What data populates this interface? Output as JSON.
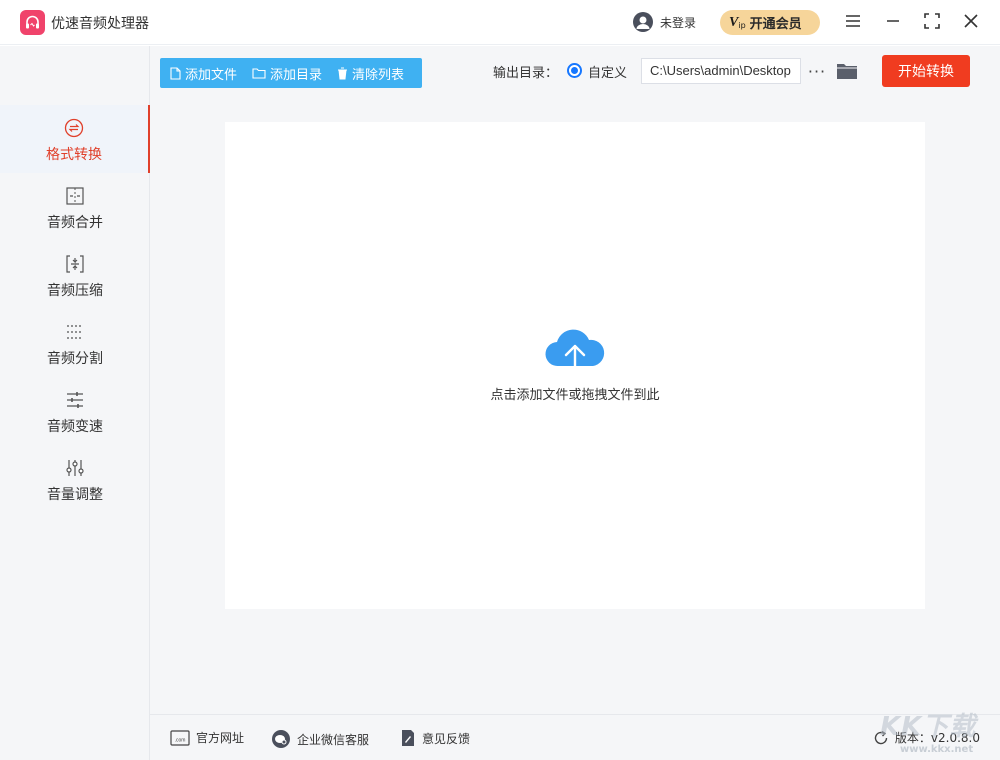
{
  "app": {
    "title": "优速音频处理器",
    "user_label": "未登录",
    "vip_badge_v": "V",
    "vip_badge_ip": "ip",
    "vip_label": "开通会员",
    "accent": "#e0402b",
    "brand_pink": "#f0436b"
  },
  "sidebar": {
    "items": [
      {
        "label": "格式转换",
        "icon": "format-convert-icon",
        "active": true
      },
      {
        "label": "音频合并",
        "icon": "merge-icon"
      },
      {
        "label": "音频压缩",
        "icon": "compress-icon"
      },
      {
        "label": "音频分割",
        "icon": "split-icon"
      },
      {
        "label": "音频变速",
        "icon": "speed-icon"
      },
      {
        "label": "音量调整",
        "icon": "volume-adjust-icon"
      }
    ]
  },
  "toolbar": {
    "add_file": "添加文件",
    "add_folder": "添加目录",
    "clear_list": "清除列表",
    "output_label": "输出目录：",
    "custom_label": "自定义",
    "output_path": "C:\\Users\\admin\\Desktop",
    "more": "···",
    "start": "开始转换"
  },
  "dropzone": {
    "hint": "点击添加文件或拖拽文件到此"
  },
  "footer": {
    "website": "官方网址",
    "wechat": "企业微信客服",
    "feedback": "意见反馈",
    "version": "版本：v2.0.8.0"
  },
  "watermark": {
    "text": "KK下载",
    "url": "www.kkx.net"
  }
}
